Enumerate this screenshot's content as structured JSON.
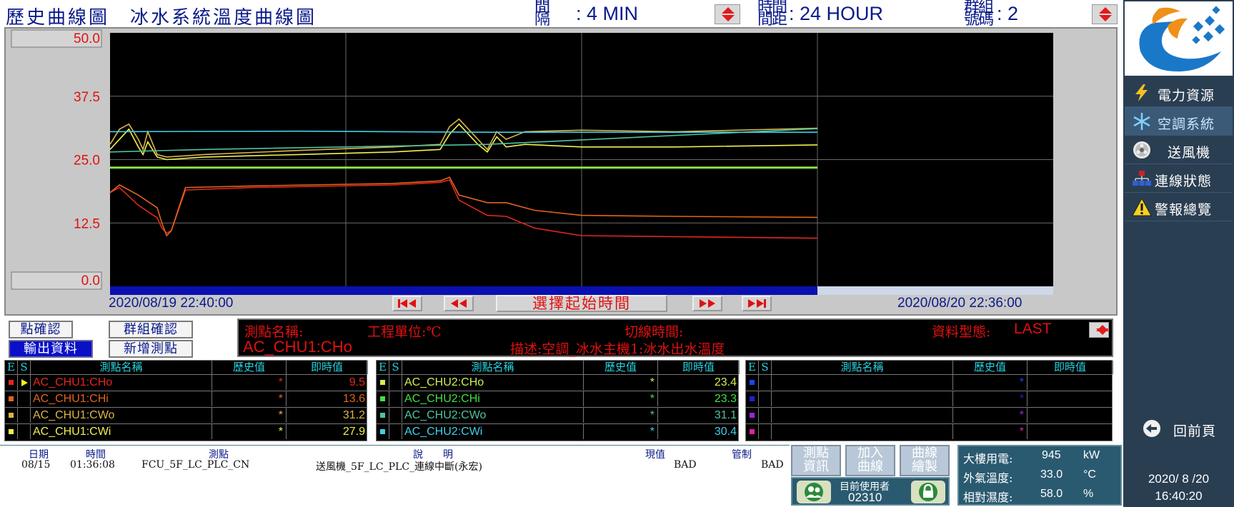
{
  "header": {
    "title": "歷史曲線圖　冰水系統溫度曲線圖",
    "interval_label_top": "間",
    "interval_label_bottom": "隔",
    "interval_value": ": 4 MIN",
    "duration_label_top": "時間",
    "duration_label_bottom": "間距",
    "duration_value": ": 24 HOUR",
    "group_label_top": "群組",
    "group_label_bottom": "號碼",
    "group_value": ": 2"
  },
  "chart_data": {
    "type": "line",
    "ylim": [
      0,
      50
    ],
    "y_ticks": [
      "50.0",
      "37.5",
      "25.0",
      "12.5",
      "0.0"
    ],
    "x_start": "2020/08/19 22:40:00",
    "x_end": "2020/08/20 22:36:00",
    "data_end_fraction": 0.75,
    "series": [
      {
        "name": "AC_CHU1:CHo",
        "color": "#e0281e",
        "t": [
          0,
          0.01,
          0.03,
          0.05,
          0.055,
          0.06,
          0.065,
          0.08,
          0.15,
          0.3,
          0.35,
          0.36,
          0.37,
          0.4,
          0.42,
          0.45,
          0.5,
          0.6,
          0.75
        ],
        "v": [
          18.5,
          19.5,
          16,
          13.5,
          11.5,
          10.5,
          11,
          19,
          19.5,
          20,
          20.5,
          21,
          17,
          14,
          13.8,
          11.5,
          10,
          9.8,
          9.5
        ]
      },
      {
        "name": "AC_CHU1:CHi",
        "color": "#e0641e",
        "t": [
          0,
          0.01,
          0.03,
          0.05,
          0.055,
          0.06,
          0.065,
          0.08,
          0.15,
          0.3,
          0.35,
          0.36,
          0.37,
          0.4,
          0.42,
          0.45,
          0.5,
          0.6,
          0.75
        ],
        "v": [
          18.5,
          20,
          18,
          15.5,
          12.5,
          10,
          11,
          19.5,
          19.8,
          20.3,
          20.8,
          21.5,
          18,
          16.5,
          16.5,
          15,
          14,
          13.8,
          13.6
        ]
      },
      {
        "name": "AC_CHU1:CWo",
        "color": "#dcb448",
        "t": [
          0,
          0.01,
          0.02,
          0.03,
          0.035,
          0.04,
          0.05,
          0.06,
          0.1,
          0.2,
          0.3,
          0.35,
          0.36,
          0.37,
          0.39,
          0.4,
          0.41,
          0.42,
          0.44,
          0.5,
          0.6,
          0.75
        ],
        "v": [
          28,
          31,
          32,
          29,
          27,
          30.5,
          26,
          25.5,
          26,
          26.8,
          27.5,
          28,
          31.5,
          33,
          29,
          27,
          30.5,
          29,
          30.5,
          30.8,
          30.5,
          31.2
        ]
      },
      {
        "name": "AC_CHU1:CWi",
        "color": "#f0f050",
        "t": [
          0,
          0.01,
          0.02,
          0.03,
          0.035,
          0.04,
          0.05,
          0.06,
          0.1,
          0.2,
          0.3,
          0.35,
          0.36,
          0.37,
          0.39,
          0.4,
          0.41,
          0.42,
          0.44,
          0.5,
          0.6,
          0.75
        ],
        "v": [
          27,
          29,
          31,
          27.5,
          26,
          28.5,
          25.5,
          25,
          25.5,
          26,
          26.5,
          27,
          30,
          32,
          28,
          26.5,
          29.5,
          27.5,
          28,
          27.5,
          27.5,
          27.9
        ]
      },
      {
        "name": "AC_CHU2:CHo",
        "color": "#d0f050",
        "t": [
          0,
          0.75
        ],
        "v": [
          23.5,
          23.5
        ]
      },
      {
        "name": "AC_CHU2:CHi",
        "color": "#40e040",
        "t": [
          0,
          0.75
        ],
        "v": [
          23.3,
          23.3
        ]
      },
      {
        "name": "AC_CHU2:CWo",
        "color": "#4fc3a0",
        "t": [
          0,
          0.1,
          0.4,
          0.75
        ],
        "v": [
          26.5,
          27,
          28,
          31.1
        ]
      },
      {
        "name": "AC_CHU2:CWi",
        "color": "#40d0e8",
        "t": [
          0,
          0.2,
          0.4,
          0.75
        ],
        "v": [
          30.5,
          30.6,
          30.4,
          30.4
        ]
      }
    ]
  },
  "nav": {
    "select_start": "選擇起始時間"
  },
  "controls": {
    "point_confirm": "點確認",
    "group_confirm": "群組確認",
    "export_data": "輸出資料",
    "add_point": "新增測點"
  },
  "info": {
    "point_name_label": "測點名稱:",
    "unit_label": "工程單位:℃",
    "switch_time_label": "切線時間:",
    "data_type_label": "資料型態:",
    "data_type_value": "LAST",
    "point_name_value": "AC_CHU1:CHo",
    "description": "描述:空調_冰水主機1:冰水出水溫度"
  },
  "table_headers": {
    "e": "E",
    "s": "S",
    "name": "測點名稱",
    "history": "歷史值",
    "realtime": "即時值"
  },
  "tables": [
    {
      "rows": [
        {
          "color": "#e0281e",
          "name": "AC_CHU1:CHo",
          "history": "*",
          "value": "9.5",
          "selected": true
        },
        {
          "color": "#e0641e",
          "name": "AC_CHU1:CHi",
          "history": "*",
          "value": "13.6"
        },
        {
          "color": "#dcb448",
          "name": "AC_CHU1:CWo",
          "history": "*",
          "value": "31.2"
        },
        {
          "color": "#f0f050",
          "name": "AC_CHU1:CWi",
          "history": "*",
          "value": "27.9"
        }
      ]
    },
    {
      "rows": [
        {
          "color": "#d0f050",
          "name": "AC_CHU2:CHo",
          "history": "*",
          "value": "23.4"
        },
        {
          "color": "#40e040",
          "name": "AC_CHU2:CHi",
          "history": "*",
          "value": "23.3"
        },
        {
          "color": "#4fc3a0",
          "name": "AC_CHU2:CWo",
          "history": "*",
          "value": "31.1"
        },
        {
          "color": "#40d0e8",
          "name": "AC_CHU2:CWi",
          "history": "*",
          "value": "30.4"
        }
      ]
    },
    {
      "rows": [
        {
          "color": "#2040ff",
          "name": "",
          "history": "*",
          "value": ""
        },
        {
          "color": "#2020d0",
          "name": "",
          "history": "*",
          "value": ""
        },
        {
          "color": "#a020e0",
          "name": "",
          "history": "*",
          "value": ""
        },
        {
          "color": "#e020a0",
          "name": "",
          "history": "*",
          "value": ""
        }
      ]
    }
  ],
  "alarm": {
    "headers": {
      "date": "日期",
      "time": "時間",
      "point": "測點",
      "desc": "說　　明",
      "value": "現值",
      "control": "管制"
    },
    "row": {
      "date": "08/15",
      "time": "01:36:08",
      "point": "FCU_5F_LC_PLC_CN",
      "desc": "送風機_5F_LC_PLC_連線中斷(永宏)",
      "value": "BAD",
      "control": "BAD"
    }
  },
  "func_buttons": {
    "point_info_1": "測點",
    "point_info_2": "資訊",
    "add_curve_1": "加入",
    "add_curve_2": "曲線",
    "draw_curve_1": "曲線",
    "draw_curve_2": "繪製"
  },
  "user": {
    "label": "目前使用者",
    "id": "02310"
  },
  "env": {
    "power_label": "大樓用電:",
    "power_value": "945",
    "power_unit": "kW",
    "temp_label": "外氣溫度:",
    "temp_value": "33.0",
    "temp_unit": "°C",
    "humidity_label": "相對濕度:",
    "humidity_value": "58.0",
    "humidity_unit": "%"
  },
  "sidebar": {
    "items": [
      {
        "label": "電力資源"
      },
      {
        "label": "空調系統"
      },
      {
        "label": "送風機"
      },
      {
        "label": "連線狀態"
      },
      {
        "label": "警報總覽"
      }
    ],
    "back": "回前頁"
  },
  "clock": {
    "date": "2020/ 8 /20",
    "time": "16:40:20"
  }
}
